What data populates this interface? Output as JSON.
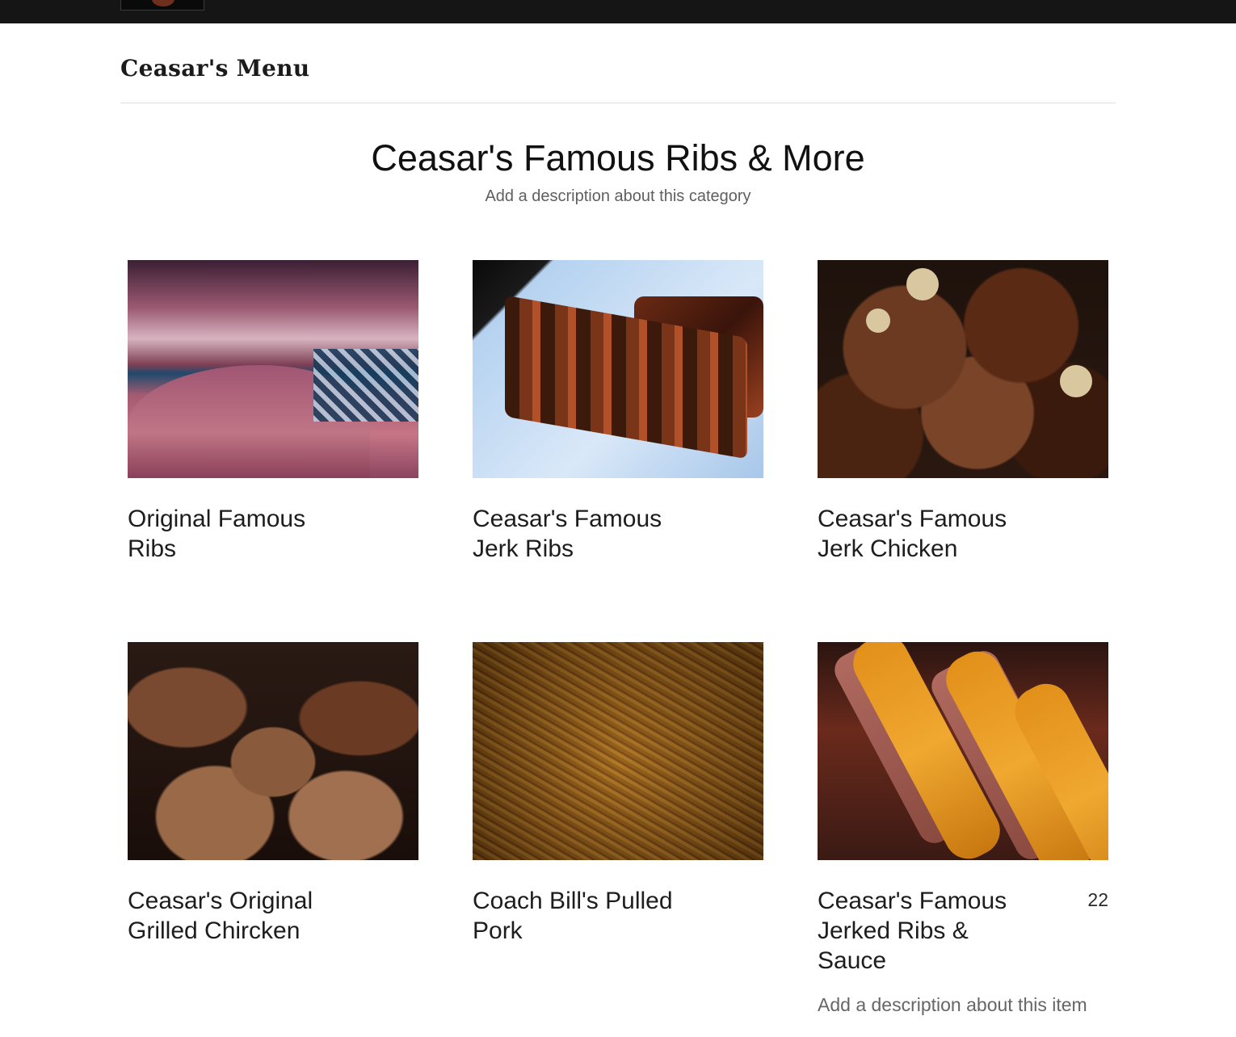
{
  "header": {
    "menu_title": "Ceasar's Menu"
  },
  "category": {
    "title": "Ceasar's Famous Ribs & More",
    "description": "Add a description about this category"
  },
  "items": [
    {
      "name": "Original Famous Ribs",
      "photo_icon": "ribs-photo"
    },
    {
      "name": "Ceasar's Famous Jerk Ribs",
      "photo_icon": "jerk-ribs-photo"
    },
    {
      "name": "Ceasar's Famous Jerk Chicken",
      "photo_icon": "jerk-chicken-photo"
    },
    {
      "name": "Ceasar's Original Grilled Chircken",
      "photo_icon": "grilled-chicken-photo"
    },
    {
      "name": "Coach Bill's Pulled Pork",
      "photo_icon": "pulled-pork-photo"
    },
    {
      "name": "Ceasar's Famous Jerked Ribs & Sauce",
      "price": "22",
      "description": "Add a description about this item",
      "photo_icon": "jerked-ribs-sauce-photo"
    }
  ],
  "colors": {
    "topbar": "#151515",
    "text": "#1d1d1d",
    "muted": "#666666",
    "divider": "#dedede"
  }
}
